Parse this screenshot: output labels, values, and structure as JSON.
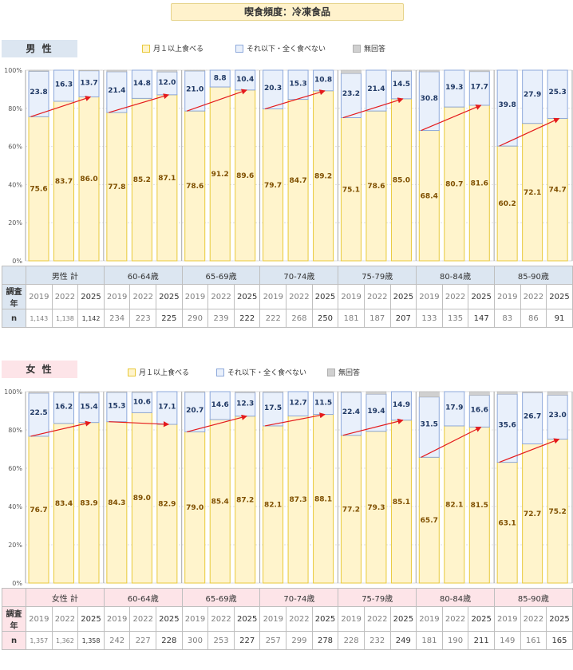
{
  "title": "喫食頻度：冷凍食品",
  "legend": {
    "monthly": "月１以上食べる",
    "less": "それ以下・全く食べない",
    "noanswer": "無回答"
  },
  "colors": {
    "monthly": "#fff4cc",
    "monthly_border": "#e8c93a",
    "less": "#e9f0fb",
    "less_border": "#8ea9db",
    "noanswer": "#d0d0d0",
    "arrow": "#e41a1c"
  },
  "labels": {
    "survey_year": "調査年",
    "n": "n"
  },
  "chart_data": [
    {
      "type": "bar",
      "gender_label": "男 性",
      "header_bg": "#dce6f1",
      "y_ticks": [
        "0%",
        "20%",
        "40%",
        "60%",
        "80%",
        "100%"
      ],
      "ylim": [
        0,
        100
      ],
      "groups": [
        {
          "label": "男性 計",
          "years": [
            "2019",
            "2022",
            "2025"
          ],
          "n": [
            "1,143",
            "1,138",
            "1,142"
          ],
          "monthly": [
            75.6,
            83.7,
            86.0
          ],
          "less": [
            23.8,
            16.3,
            13.7
          ],
          "noanswer": [
            0.6,
            0.0,
            0.3
          ]
        },
        {
          "label": "60-64歳",
          "years": [
            "2019",
            "2022",
            "2025"
          ],
          "n": [
            "234",
            "223",
            "225"
          ],
          "monthly": [
            77.8,
            85.2,
            87.1
          ],
          "less": [
            21.4,
            14.8,
            12.0
          ],
          "noanswer": [
            0.8,
            0.0,
            0.9
          ]
        },
        {
          "label": "65-69歳",
          "years": [
            "2019",
            "2022",
            "2025"
          ],
          "n": [
            "290",
            "239",
            "222"
          ],
          "monthly": [
            78.6,
            91.2,
            89.6
          ],
          "less": [
            21.0,
            8.8,
            10.4
          ],
          "noanswer": [
            0.4,
            0.0,
            0.0
          ]
        },
        {
          "label": "70-74歳",
          "years": [
            "2019",
            "2022",
            "2025"
          ],
          "n": [
            "222",
            "268",
            "250"
          ],
          "monthly": [
            79.7,
            84.7,
            89.2
          ],
          "less": [
            20.3,
            15.3,
            10.8
          ],
          "noanswer": [
            0.0,
            0.0,
            0.0
          ]
        },
        {
          "label": "75-79歳",
          "years": [
            "2019",
            "2022",
            "2025"
          ],
          "n": [
            "181",
            "187",
            "207"
          ],
          "monthly": [
            75.1,
            78.6,
            85.0
          ],
          "less": [
            23.2,
            21.4,
            14.5
          ],
          "noanswer": [
            1.7,
            0.0,
            0.5
          ]
        },
        {
          "label": "80-84歳",
          "years": [
            "2019",
            "2022",
            "2025"
          ],
          "n": [
            "133",
            "135",
            "147"
          ],
          "monthly": [
            68.4,
            80.7,
            81.6
          ],
          "less": [
            30.8,
            19.3,
            17.7
          ],
          "noanswer": [
            0.8,
            0.0,
            0.7
          ]
        },
        {
          "label": "85-90歳",
          "years": [
            "2019",
            "2022",
            "2025"
          ],
          "n": [
            "83",
            "86",
            "91"
          ],
          "monthly": [
            60.2,
            72.1,
            74.7
          ],
          "less": [
            39.8,
            27.9,
            25.3
          ],
          "noanswer": [
            0.0,
            0.0,
            0.0
          ]
        }
      ]
    },
    {
      "type": "bar",
      "gender_label": "女 性",
      "header_bg": "#fde4e8",
      "y_ticks": [
        "0%",
        "20%",
        "40%",
        "60%",
        "80%",
        "100%"
      ],
      "ylim": [
        0,
        100
      ],
      "groups": [
        {
          "label": "女性 計",
          "years": [
            "2019",
            "2022",
            "2025"
          ],
          "n": [
            "1,357",
            "1,362",
            "1,358"
          ],
          "monthly": [
            76.7,
            83.4,
            83.9
          ],
          "less": [
            22.5,
            16.2,
            15.4
          ],
          "noanswer": [
            0.8,
            0.4,
            0.7
          ]
        },
        {
          "label": "60-64歳",
          "years": [
            "2019",
            "2022",
            "2025"
          ],
          "n": [
            "242",
            "227",
            "228"
          ],
          "monthly": [
            84.3,
            89.0,
            82.9
          ],
          "less": [
            15.3,
            10.6,
            17.1
          ],
          "noanswer": [
            0.4,
            0.4,
            0.0
          ]
        },
        {
          "label": "65-69歳",
          "years": [
            "2019",
            "2022",
            "2025"
          ],
          "n": [
            "300",
            "253",
            "227"
          ],
          "monthly": [
            79.0,
            85.4,
            87.2
          ],
          "less": [
            20.7,
            14.6,
            12.3
          ],
          "noanswer": [
            0.3,
            0.0,
            0.5
          ]
        },
        {
          "label": "70-74歳",
          "years": [
            "2019",
            "2022",
            "2025"
          ],
          "n": [
            "257",
            "299",
            "278"
          ],
          "monthly": [
            82.1,
            87.3,
            88.1
          ],
          "less": [
            17.5,
            12.7,
            11.5
          ],
          "noanswer": [
            0.4,
            0.0,
            0.4
          ]
        },
        {
          "label": "75-79歳",
          "years": [
            "2019",
            "2022",
            "2025"
          ],
          "n": [
            "228",
            "232",
            "249"
          ],
          "monthly": [
            77.2,
            79.3,
            85.1
          ],
          "less": [
            22.4,
            19.4,
            14.9
          ],
          "noanswer": [
            0.4,
            1.3,
            0.0
          ]
        },
        {
          "label": "80-84歳",
          "years": [
            "2019",
            "2022",
            "2025"
          ],
          "n": [
            "181",
            "190",
            "211"
          ],
          "monthly": [
            65.7,
            82.1,
            81.5
          ],
          "less": [
            31.5,
            17.9,
            16.6
          ],
          "noanswer": [
            2.8,
            0.0,
            1.9
          ]
        },
        {
          "label": "85-90歳",
          "years": [
            "2019",
            "2022",
            "2025"
          ],
          "n": [
            "149",
            "161",
            "165"
          ],
          "monthly": [
            63.1,
            72.7,
            75.2
          ],
          "less": [
            35.6,
            26.7,
            23.0
          ],
          "noanswer": [
            1.3,
            0.6,
            1.8
          ]
        }
      ]
    }
  ]
}
